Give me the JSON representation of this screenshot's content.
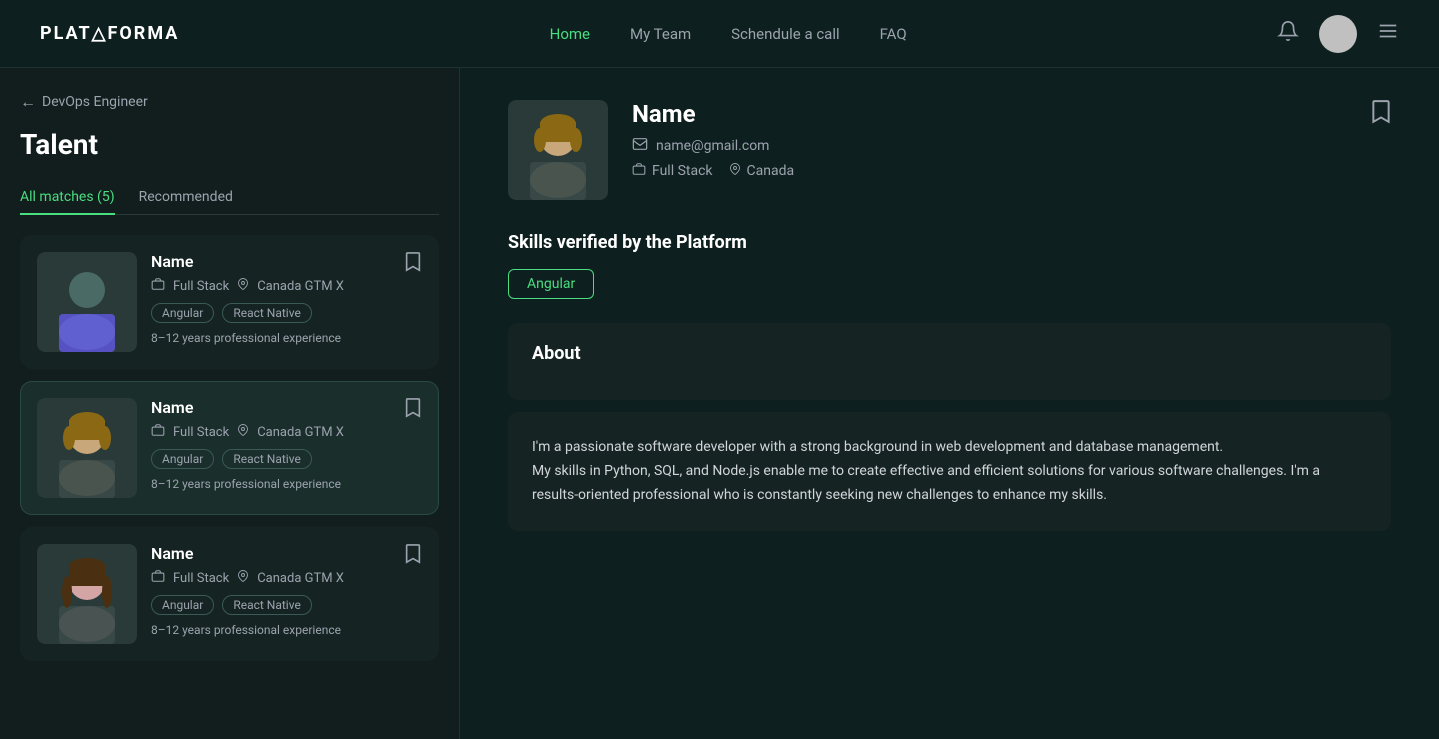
{
  "navbar": {
    "logo": "PLAT△FORMA",
    "links": [
      {
        "label": "Home",
        "active": true
      },
      {
        "label": "My Team",
        "active": false
      },
      {
        "label": "Schendule a call",
        "active": false
      },
      {
        "label": "FAQ",
        "active": false
      }
    ]
  },
  "sidebar": {
    "back_label": "DevOps Engineer",
    "title": "Talent",
    "tabs": [
      {
        "label": "All matches (5)",
        "active": true
      },
      {
        "label": "Recommended",
        "active": false
      }
    ],
    "candidates": [
      {
        "name": "Name",
        "role": "Full Stack",
        "location": "Canada GTM X",
        "skills": [
          "Angular",
          "React Native"
        ],
        "experience": "8–12 years professional experience",
        "selected": false
      },
      {
        "name": "Name",
        "role": "Full Stack",
        "location": "Canada GTM X",
        "skills": [
          "Angular",
          "React Native"
        ],
        "experience": "8–12 years professional experience",
        "selected": true
      },
      {
        "name": "Name",
        "role": "Full Stack",
        "location": "Canada GTM X",
        "skills": [
          "Angular",
          "React Native"
        ],
        "experience": "8–12 years professional experience",
        "selected": false
      }
    ]
  },
  "detail": {
    "name": "Name",
    "email": "name@gmail.com",
    "role": "Full Stack",
    "location": "Canada",
    "skills_title": "Skills verified by the Platform",
    "skills": [
      "Angular"
    ],
    "about_title": "About",
    "about_text": "I'm a passionate software developer with a strong background in web development and database management.\nMy skills in Python, SQL, and Node.js enable me to create effective and efficient solutions for various software challenges. I'm a results-oriented professional who is constantly seeking new challenges to enhance my skills."
  }
}
